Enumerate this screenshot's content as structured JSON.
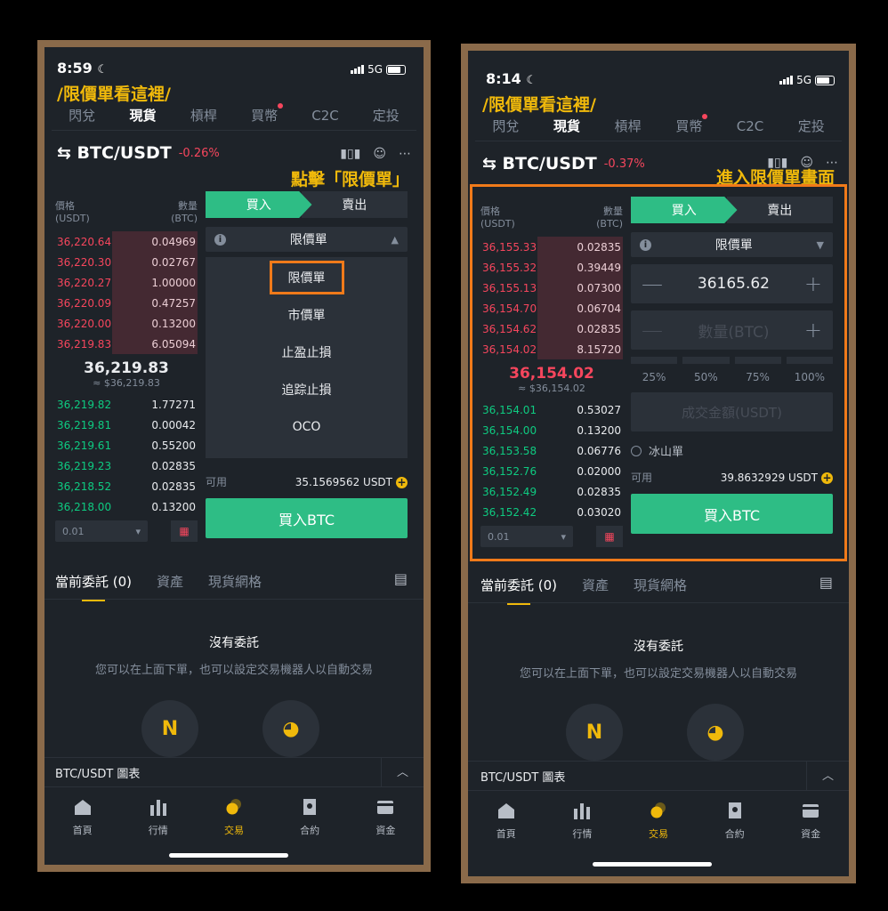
{
  "left": {
    "status": {
      "time": "8:59",
      "network": "5G"
    },
    "annotation_top": "/限價單看這裡/",
    "annotation_right": "點擊「限價單」",
    "tabs": [
      "閃兌",
      "現貨",
      "槓桿",
      "買幣",
      "C2C",
      "定投"
    ],
    "pair": "⇆ BTC/USDT",
    "change": "-0.26%",
    "orderbook": {
      "price_header": "價格",
      "price_unit": "(USDT)",
      "qty_header": "數量",
      "qty_unit": "(BTC)",
      "asks": [
        {
          "p": "36,220.64",
          "q": "0.04969"
        },
        {
          "p": "36,220.30",
          "q": "0.02767"
        },
        {
          "p": "36,220.27",
          "q": "1.00000"
        },
        {
          "p": "36,220.09",
          "q": "0.47257"
        },
        {
          "p": "36,220.00",
          "q": "0.13200"
        },
        {
          "p": "36,219.83",
          "q": "6.05094"
        }
      ],
      "mid": "36,219.83",
      "mid_sub": "≈ $36,219.83",
      "bids": [
        {
          "p": "36,219.82",
          "q": "1.77271"
        },
        {
          "p": "36,219.81",
          "q": "0.00042"
        },
        {
          "p": "36,219.61",
          "q": "0.55200"
        },
        {
          "p": "36,219.23",
          "q": "0.02835"
        },
        {
          "p": "36,218.52",
          "q": "0.02835"
        },
        {
          "p": "36,218.00",
          "q": "0.13200"
        }
      ],
      "depth": "0.01"
    },
    "buy": "買入",
    "sell": "賣出",
    "order_type": "限價單",
    "dropdown": [
      "限價單",
      "市價單",
      "止盈止損",
      "追踪止損",
      "OCO"
    ],
    "available_label": "可用",
    "available_value": "35.1569562 USDT",
    "buy_button": "買入BTC",
    "bottom_tabs": [
      "當前委託 (0)",
      "資產",
      "現貨網格"
    ],
    "empty_title": "沒有委託",
    "empty_sub": "您可以在上面下單，也可以設定交易機器人以自動交易",
    "chart_label": "BTC/USDT 圖表",
    "nav": [
      "首頁",
      "行情",
      "交易",
      "合約",
      "資金"
    ]
  },
  "right": {
    "status": {
      "time": "8:14",
      "network": "5G"
    },
    "annotation_top": "/限價單看這裡/",
    "annotation_right": "進入限價單畫面",
    "tabs": [
      "閃兌",
      "現貨",
      "槓桿",
      "買幣",
      "C2C",
      "定投"
    ],
    "pair": "⇆ BTC/USDT",
    "change": "-0.37%",
    "orderbook": {
      "price_header": "價格",
      "price_unit": "(USDT)",
      "qty_header": "數量",
      "qty_unit": "(BTC)",
      "asks": [
        {
          "p": "36,155.33",
          "q": "0.02835"
        },
        {
          "p": "36,155.32",
          "q": "0.39449"
        },
        {
          "p": "36,155.13",
          "q": "0.07300"
        },
        {
          "p": "36,154.70",
          "q": "0.06704"
        },
        {
          "p": "36,154.62",
          "q": "0.02835"
        },
        {
          "p": "36,154.02",
          "q": "8.15720"
        }
      ],
      "mid": "36,154.02",
      "mid_sub": "≈ $36,154.02",
      "bids": [
        {
          "p": "36,154.01",
          "q": "0.53027"
        },
        {
          "p": "36,154.00",
          "q": "0.13200"
        },
        {
          "p": "36,153.58",
          "q": "0.06776"
        },
        {
          "p": "36,152.76",
          "q": "0.02000"
        },
        {
          "p": "36,152.49",
          "q": "0.02835"
        },
        {
          "p": "36,152.42",
          "q": "0.03020"
        }
      ],
      "depth": "0.01"
    },
    "buy": "買入",
    "sell": "賣出",
    "order_type": "限價單",
    "price_value": "36165.62",
    "qty_placeholder": "數量(BTC)",
    "percents": [
      "25%",
      "50%",
      "75%",
      "100%"
    ],
    "total_placeholder": "成交金額(USDT)",
    "iceberg": "冰山單",
    "available_label": "可用",
    "available_value": "39.8632929 USDT",
    "buy_button": "買入BTC",
    "bottom_tabs": [
      "當前委託 (0)",
      "資產",
      "現貨網格"
    ],
    "empty_title": "沒有委託",
    "empty_sub": "您可以在上面下單，也可以設定交易機器人以自動交易",
    "chart_label": "BTC/USDT 圖表",
    "nav": [
      "首頁",
      "行情",
      "交易",
      "合約",
      "資金"
    ]
  },
  "colors": {
    "accent": "#f0b90b",
    "buy": "#2ebd85",
    "ask": "#f6465d",
    "bid": "#0ecb81",
    "highlight": "#f07a1a",
    "bg": "#1e2329",
    "panel": "#2b3139"
  }
}
